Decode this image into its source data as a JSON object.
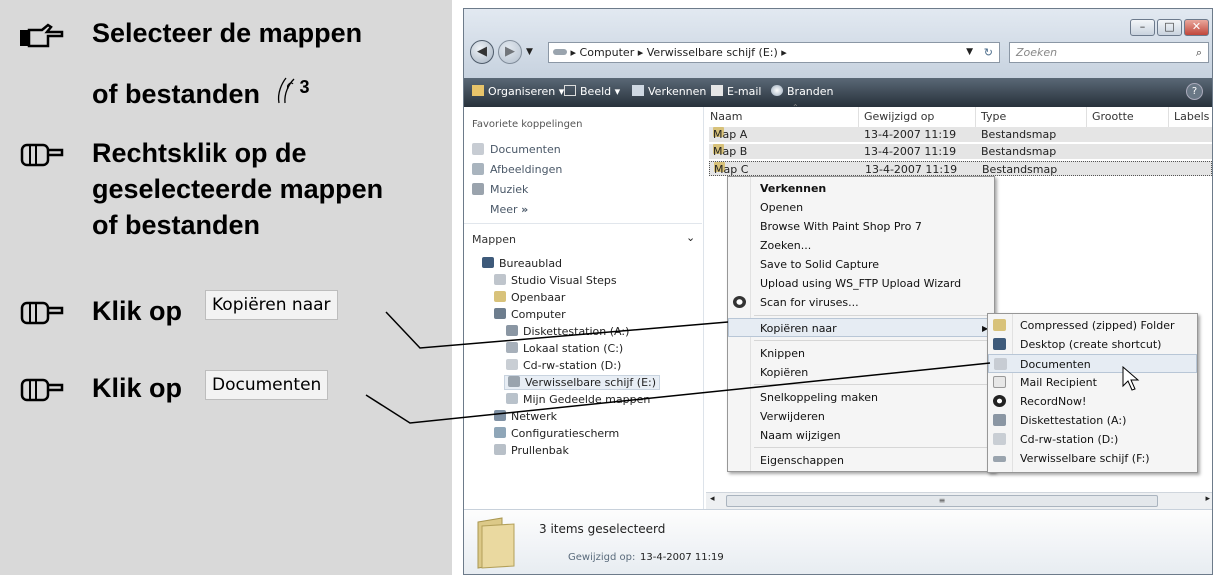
{
  "instructions": {
    "step1": {
      "line1": "Selecteer de mappen",
      "line2": "of bestanden",
      "superscript": "3"
    },
    "step2": {
      "line1": "Rechtsklik op de",
      "line2": "geselecteerde mappen",
      "line3": "of bestanden"
    },
    "step3": {
      "text": "Klik op",
      "button": "Kopiëren naar"
    },
    "step4": {
      "text": "Klik op",
      "button": "Documenten"
    }
  },
  "explorer": {
    "breadcrumb": [
      "Computer",
      "Verwisselbare schijf (E:)"
    ],
    "search_placeholder": "Zoeken",
    "toolbar": [
      "Organiseren",
      "Beeld",
      "Verkennen",
      "E-mail",
      "Branden"
    ],
    "help_label": "?",
    "nav": {
      "favorites_header": "Favoriete koppelingen",
      "favorites": [
        "Documenten",
        "Afbeeldingen",
        "Muziek"
      ],
      "more": "Meer",
      "folders_header": "Mappen",
      "tree": [
        "Bureaublad",
        "Studio Visual Steps",
        "Openbaar",
        "Computer",
        "Diskettestation (A:)",
        "Lokaal station (C:)",
        "Cd-rw-station (D:)",
        "Verwisselbare schijf (E:)",
        "Mijn Gedeelde mappen",
        "Netwerk",
        "Configuratiescherm",
        "Prullenbak"
      ]
    },
    "columns": [
      "Naam",
      "Gewijzigd op",
      "Type",
      "Grootte",
      "Labels"
    ],
    "rows": [
      {
        "name": "Map A",
        "modified": "13-4-2007 11:19",
        "type": "Bestandsmap"
      },
      {
        "name": "Map B",
        "modified": "13-4-2007 11:19",
        "type": "Bestandsmap"
      },
      {
        "name": "Map C",
        "modified": "13-4-2007 11:19",
        "type": "Bestandsmap"
      }
    ],
    "context_menu": [
      "Verkennen",
      "Openen",
      "Browse With Paint Shop Pro 7",
      "Zoeken...",
      "Save to Solid Capture",
      "Upload using WS_FTP Upload Wizard",
      "Scan for viruses...",
      "Kopiëren naar",
      "Knippen",
      "Kopiëren",
      "Snelkoppeling maken",
      "Verwijderen",
      "Naam wijzigen",
      "Eigenschappen"
    ],
    "submenu": [
      "Compressed (zipped) Folder",
      "Desktop (create shortcut)",
      "Documenten",
      "Mail Recipient",
      "RecordNow!",
      "Diskettestation (A:)",
      "Cd-rw-station (D:)",
      "Verwisselbare schijf (F:)"
    ],
    "details": {
      "summary": "3 items geselecteerd",
      "modified_label": "Gewijzigd op:",
      "modified_value": "13-4-2007 11:19"
    }
  },
  "colors": {
    "panel_bg": "#d9d9d9",
    "toolbar_bg": "#3a4652",
    "menu_highlight": "#e6ecf3"
  }
}
